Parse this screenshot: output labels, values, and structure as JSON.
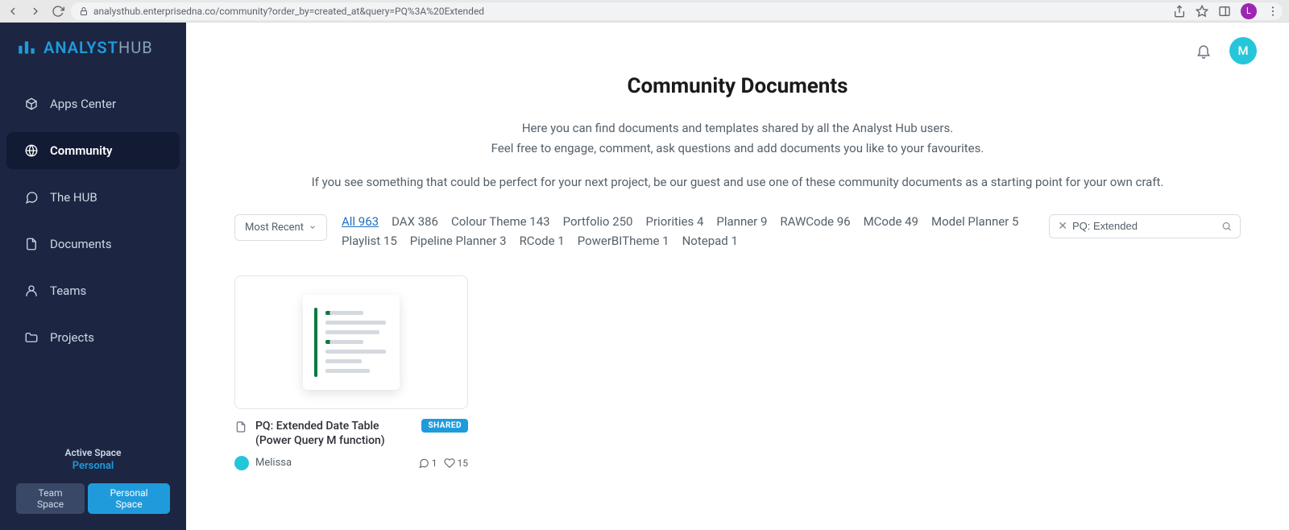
{
  "browser": {
    "url": "analysthub.enterprisedna.co/community?order_by=created_at&query=PQ%3A%20Extended",
    "profile_letter": "L"
  },
  "logo": {
    "primary": "ANALYST",
    "secondary": "HUB"
  },
  "sidebar": {
    "items": [
      {
        "label": "Apps Center"
      },
      {
        "label": "Community"
      },
      {
        "label": "The HUB"
      },
      {
        "label": "Documents"
      },
      {
        "label": "Teams"
      },
      {
        "label": "Projects"
      }
    ],
    "active_space_label": "Active Space",
    "active_space_value": "Personal",
    "tabs": {
      "team": "Team Space",
      "personal": "Personal Space"
    }
  },
  "topbar": {
    "avatar_letter": "M"
  },
  "page": {
    "title": "Community Documents",
    "intro1": "Here you can find documents and templates shared by all the Analyst Hub users.",
    "intro2": "Feel free to engage, comment, ask questions and add documents you like to your favourites.",
    "intro3": "If you see something that could be perfect for your next project, be our guest and use one of these community documents as a starting point for your own craft."
  },
  "filters": {
    "sort_label": "Most Recent",
    "tags": [
      "All 963",
      "DAX 386",
      "Colour Theme 143",
      "Portfolio 250",
      "Priorities 4",
      "Planner 9",
      "RAWCode 96",
      "MCode 49",
      "Model Planner 5",
      "Playlist 15",
      "Pipeline Planner 3",
      "RCode 1",
      "PowerBITheme 1",
      "Notepad 1"
    ],
    "search_value": "PQ: Extended"
  },
  "cards": [
    {
      "title": "PQ: Extended Date Table (Power Query M function)",
      "badge": "SHARED",
      "author": "Melissa",
      "comments": "1",
      "likes": "15"
    }
  ]
}
